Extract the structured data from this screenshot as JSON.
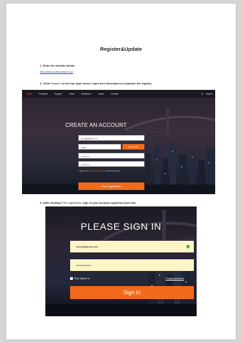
{
  "doc": {
    "title": "Register&Update",
    "step1": {
      "num": "1.",
      "text": "Enter the website below:"
    },
    "link": "http://www.sofarsolltech.cp/",
    "step2": {
      "num": "2.",
      "prefix": "Click",
      "em": "Register",
      "suffix": "on the top right corner, input the information to complete the register."
    },
    "step3": {
      "num": "3.",
      "prefix": "After clicking",
      "em": "Free registration",
      "suffix": ", sign in your account registered just now."
    }
  },
  "shot1": {
    "nav": [
      "Home",
      "Products",
      "Support",
      "News",
      "Distributor",
      "About",
      "Contact"
    ],
    "nav_right": [
      "Q",
      "Imprint"
    ],
    "title": "CREATE AN ACCOUNT",
    "fields": [
      {
        "value": "anne@gmail.com"
      },
      {
        "value": "code"
      },
      {
        "value": "••••••••••••"
      },
      {
        "value": "••••••••••••"
      }
    ],
    "code_button": "Send code",
    "agree_text": "I agree to the",
    "agree_link": "Terms & Conditions",
    "agree_tail": "and Privacy Policy",
    "submit": "Free registration"
  },
  "shot2": {
    "title": "PLEASE SIGN IN",
    "email": "anne@gmail.com",
    "password": "•••••••••••••••",
    "remember": "Stay signed in",
    "forgot": "Forgot password",
    "submit": "Sign In"
  }
}
